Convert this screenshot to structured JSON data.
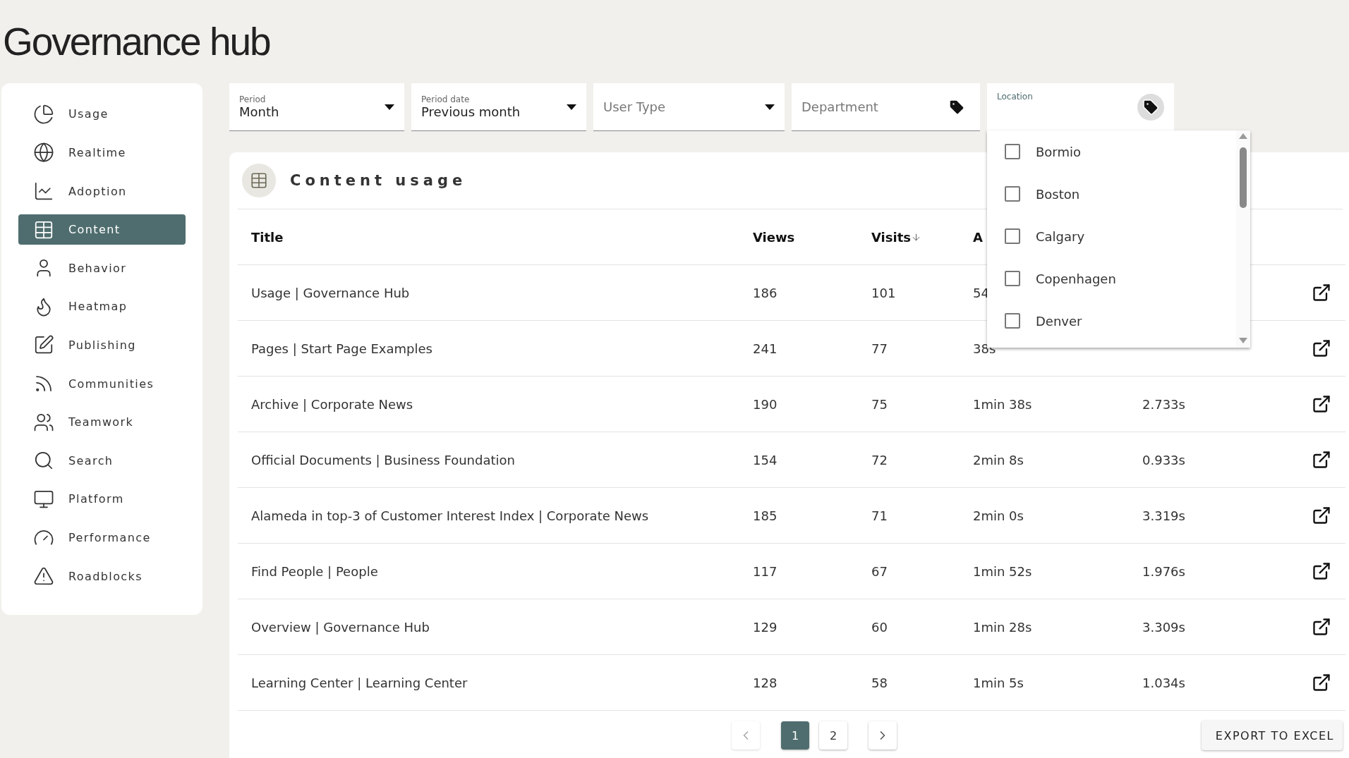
{
  "page_title": "Governance hub",
  "sidebar": {
    "items": [
      {
        "label": "Usage",
        "selected": false
      },
      {
        "label": "Realtime",
        "selected": false
      },
      {
        "label": "Adoption",
        "selected": false
      },
      {
        "label": "Content",
        "selected": true
      },
      {
        "label": "Behavior",
        "selected": false
      },
      {
        "label": "Heatmap",
        "selected": false
      },
      {
        "label": "Publishing",
        "selected": false
      },
      {
        "label": "Communities",
        "selected": false
      },
      {
        "label": "Teamwork",
        "selected": false
      },
      {
        "label": "Search",
        "selected": false
      },
      {
        "label": "Platform",
        "selected": false
      },
      {
        "label": "Performance",
        "selected": false
      },
      {
        "label": "Roadblocks",
        "selected": false
      }
    ]
  },
  "filters": [
    {
      "kind": "select",
      "label": "Period",
      "value": "Month",
      "open": false
    },
    {
      "kind": "select",
      "label": "Period date",
      "value": "Previous month",
      "open": false
    },
    {
      "kind": "select",
      "label": "User Type",
      "open": false
    },
    {
      "kind": "tag",
      "label": "Department",
      "open": false
    },
    {
      "kind": "tag",
      "label": "Location",
      "open": true,
      "options": [
        {
          "label": "Bormio",
          "checked": false
        },
        {
          "label": "Boston",
          "checked": false
        },
        {
          "label": "Calgary",
          "checked": false
        },
        {
          "label": "Copenhagen",
          "checked": false
        },
        {
          "label": "Denver",
          "checked": false
        }
      ]
    }
  ],
  "card": {
    "title": "Content usage",
    "table": {
      "columns": [
        {
          "label": "Title",
          "sorted": false
        },
        {
          "label": "Views",
          "sorted": false
        },
        {
          "label": "Visits",
          "sorted": true
        },
        {
          "label": "A",
          "sorted": false
        }
      ],
      "rows": [
        {
          "title": "Usage | Governance Hub",
          "views": "186",
          "visits": "101",
          "avg_time": "54"
        },
        {
          "title": "Pages | Start Page Examples",
          "views": "241",
          "visits": "77",
          "avg_time": "38s"
        },
        {
          "title": "Archive | Corporate News",
          "views": "190",
          "visits": "75",
          "avg_time": "1min 38s",
          "load_time": "2.733s"
        },
        {
          "title": "Official Documents | Business Foundation",
          "views": "154",
          "visits": "72",
          "avg_time": "2min 8s",
          "load_time": "0.933s"
        },
        {
          "title": "Alameda in top-3 of Customer Interest Index | Corporate News",
          "views": "185",
          "visits": "71",
          "avg_time": "2min 0s",
          "load_time": "3.319s"
        },
        {
          "title": "Find People | People",
          "views": "117",
          "visits": "67",
          "avg_time": "1min 52s",
          "load_time": "1.976s"
        },
        {
          "title": "Overview | Governance Hub",
          "views": "129",
          "visits": "60",
          "avg_time": "1min 28s",
          "load_time": "3.309s"
        },
        {
          "title": "Learning Center | Learning Center",
          "views": "128",
          "visits": "58",
          "avg_time": "1min 5s",
          "load_time": "1.034s"
        }
      ]
    },
    "pagination": {
      "previous": {
        "disabled": true
      },
      "pages": [
        {
          "label": "1",
          "selected": true
        },
        {
          "label": "2",
          "selected": false
        }
      ],
      "next": {
        "disabled": false
      }
    },
    "export_button": "EXPORT TO EXCEL"
  }
}
